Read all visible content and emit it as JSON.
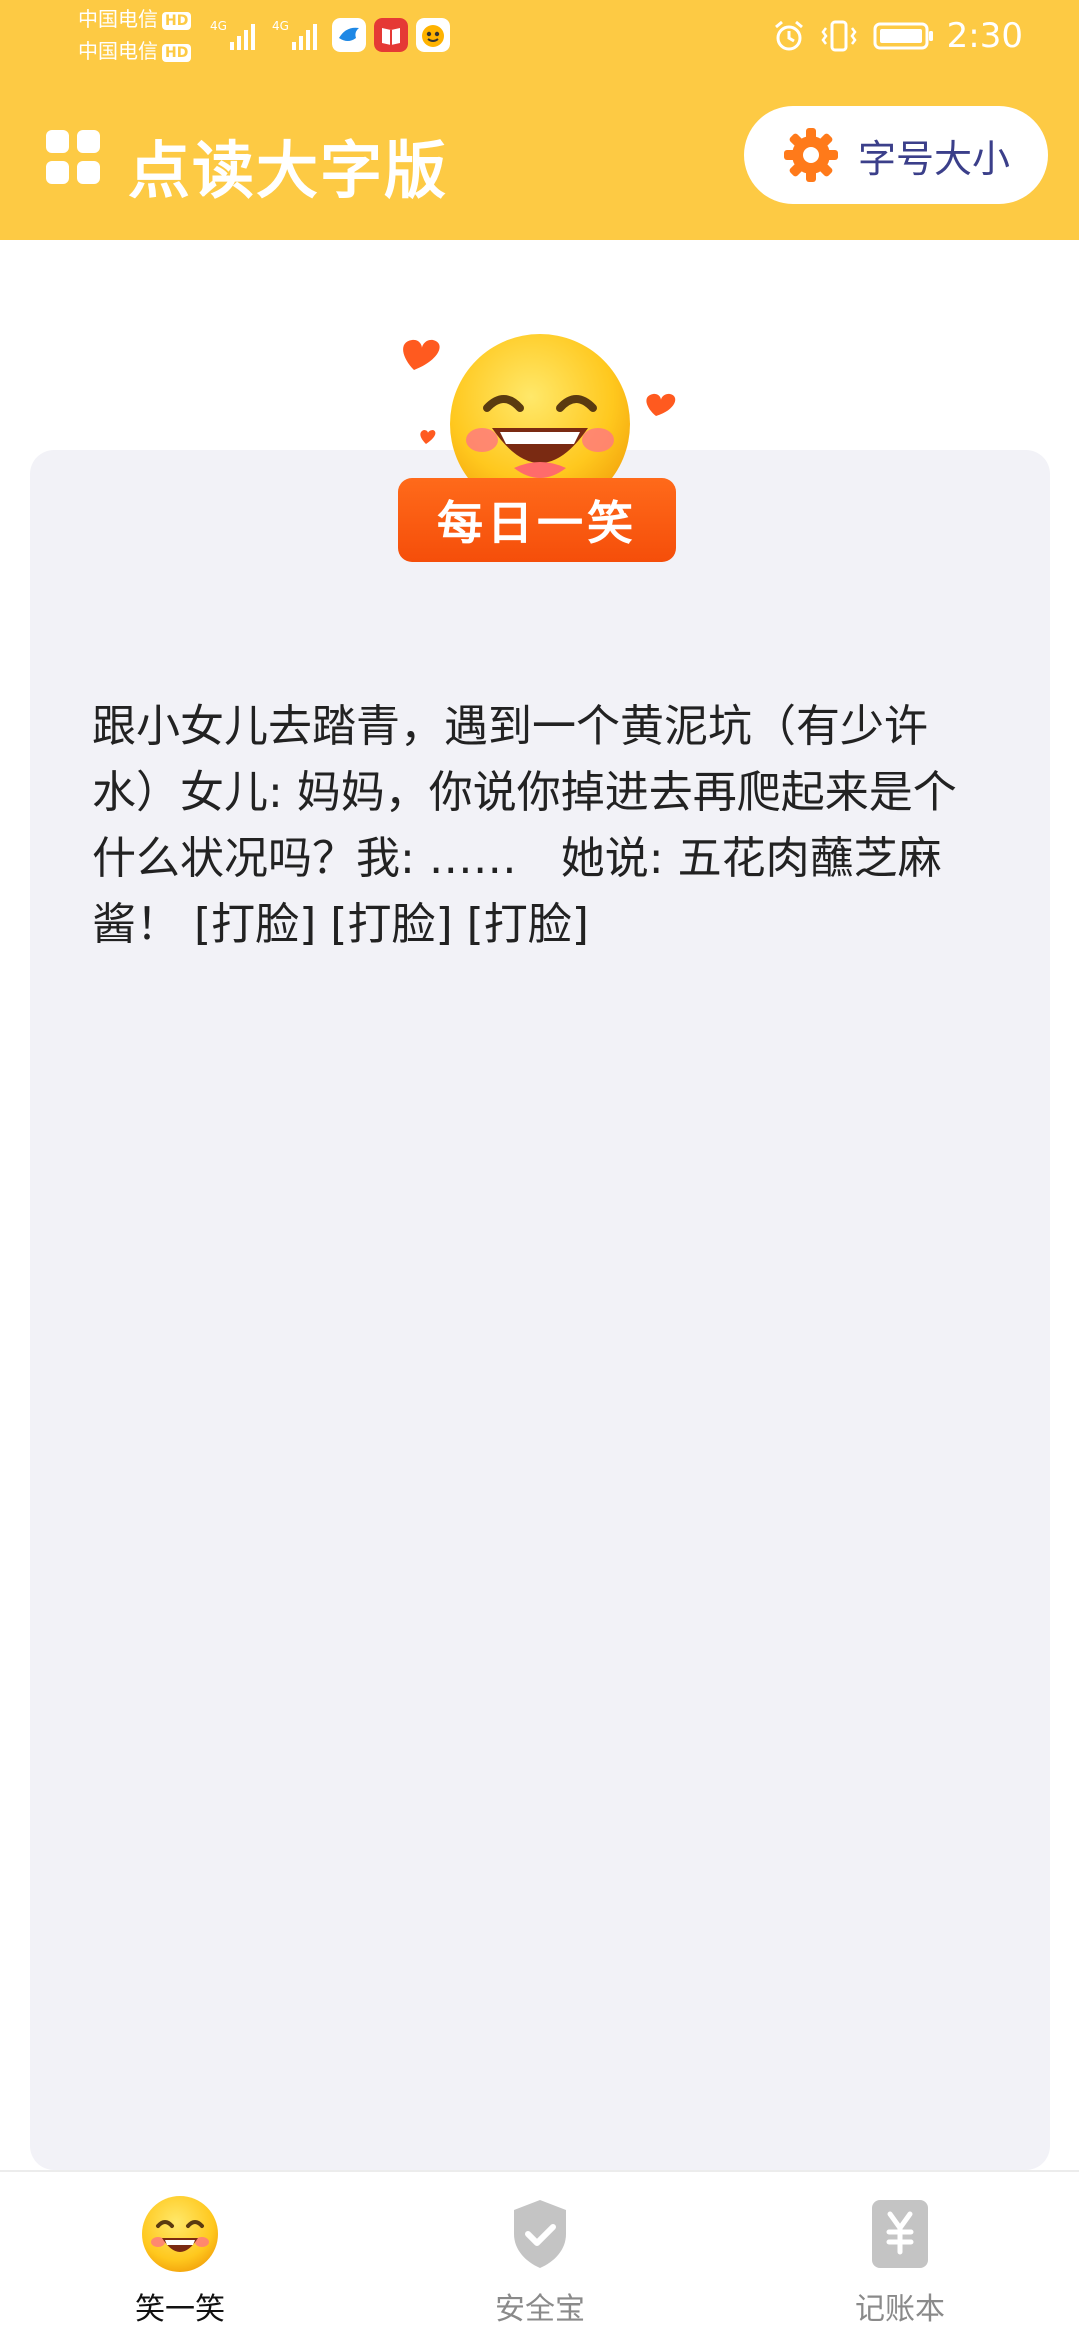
{
  "status_bar": {
    "carrier_1": "中国电信",
    "carrier_2": "中国电信",
    "hd_badge": "HD",
    "network_1": "4G",
    "network_2": "4G",
    "time": "2:30",
    "icons": [
      "signal-icon",
      "signal-icon",
      "bird-app-icon",
      "book-app-icon",
      "cartoon-app-icon",
      "alarm-icon",
      "vibrate-icon",
      "battery-icon"
    ]
  },
  "header": {
    "title": "点读大字版",
    "font_size_button": "字号大小",
    "background_color": "#FDCA44"
  },
  "card": {
    "badge": "每日一笑",
    "joke_text": "跟小女儿去踏青，遇到一个黄泥坑（有少许水）女儿: 妈妈，你说你掉进去再爬起来是个什么状况吗？我: ……　她说: 五花肉蘸芝麻酱！ [打脸] [打脸] [打脸]"
  },
  "tabs": [
    {
      "label": "笑一笑",
      "icon": "smiley-icon",
      "active": true
    },
    {
      "label": "安全宝",
      "icon": "shield-check-icon",
      "active": false
    },
    {
      "label": "记账本",
      "icon": "yuan-ledger-icon",
      "active": false
    }
  ]
}
